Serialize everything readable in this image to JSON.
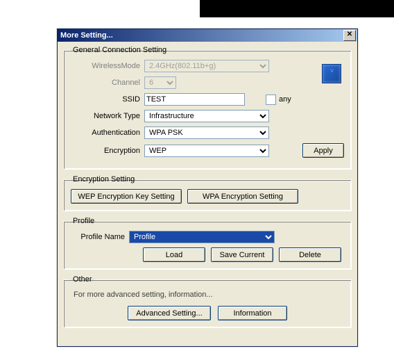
{
  "window": {
    "title": "More Setting..."
  },
  "general": {
    "legend": "General Connection Setting",
    "wireless_mode_label": "WirelessMode",
    "wireless_mode_value": "2.4GHz(802.11b+g)",
    "channel_label": "Channel",
    "channel_value": "6",
    "ssid_label": "SSID",
    "ssid_value": "TEST",
    "any_label": "any",
    "network_type_label": "Network Type",
    "network_type_value": "Infrastructure",
    "authentication_label": "Authentication",
    "authentication_value": "WPA PSK",
    "encryption_label": "Encryption",
    "encryption_value": "WEP",
    "apply_label": "Apply"
  },
  "encryption": {
    "legend": "Encryption Setting",
    "wep_button": "WEP Encryption Key Setting",
    "wpa_button": "WPA Encryption Setting"
  },
  "profile": {
    "legend": "Profile",
    "name_label": "Profile Name",
    "name_value": "Profile",
    "load_label": "Load",
    "save_label": "Save Current",
    "delete_label": "Delete"
  },
  "other": {
    "legend": "Other",
    "text": "For more advanced setting, information...",
    "adv_label": "Advanced Setting...",
    "info_label": "Information"
  }
}
